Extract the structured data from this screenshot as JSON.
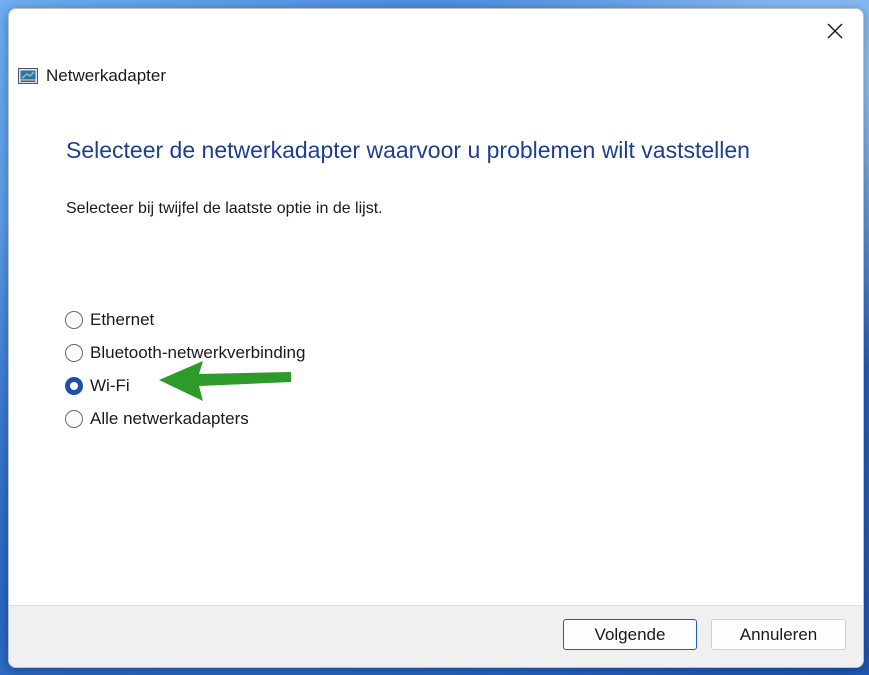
{
  "window": {
    "title": "Netwerkadapter",
    "close_icon": "close-icon",
    "app_icon": "network-adapter-icon"
  },
  "content": {
    "heading": "Selecteer de netwerkadapter waarvoor u problemen wilt vaststellen",
    "instruction": "Selecteer bij twijfel de laatste optie in de lijst.",
    "options": [
      {
        "label": "Ethernet",
        "selected": false
      },
      {
        "label": "Bluetooth-netwerkverbinding",
        "selected": false
      },
      {
        "label": "Wi-Fi",
        "selected": true
      },
      {
        "label": "Alle netwerkadapters",
        "selected": false
      }
    ]
  },
  "annotation": {
    "arrow_color": "#2e9a2a",
    "points_to": "Wi-Fi"
  },
  "footer": {
    "next_label": "Volgende",
    "cancel_label": "Annuleren"
  },
  "colors": {
    "heading": "#1e3f8f",
    "accent": "#1f4fa8"
  }
}
